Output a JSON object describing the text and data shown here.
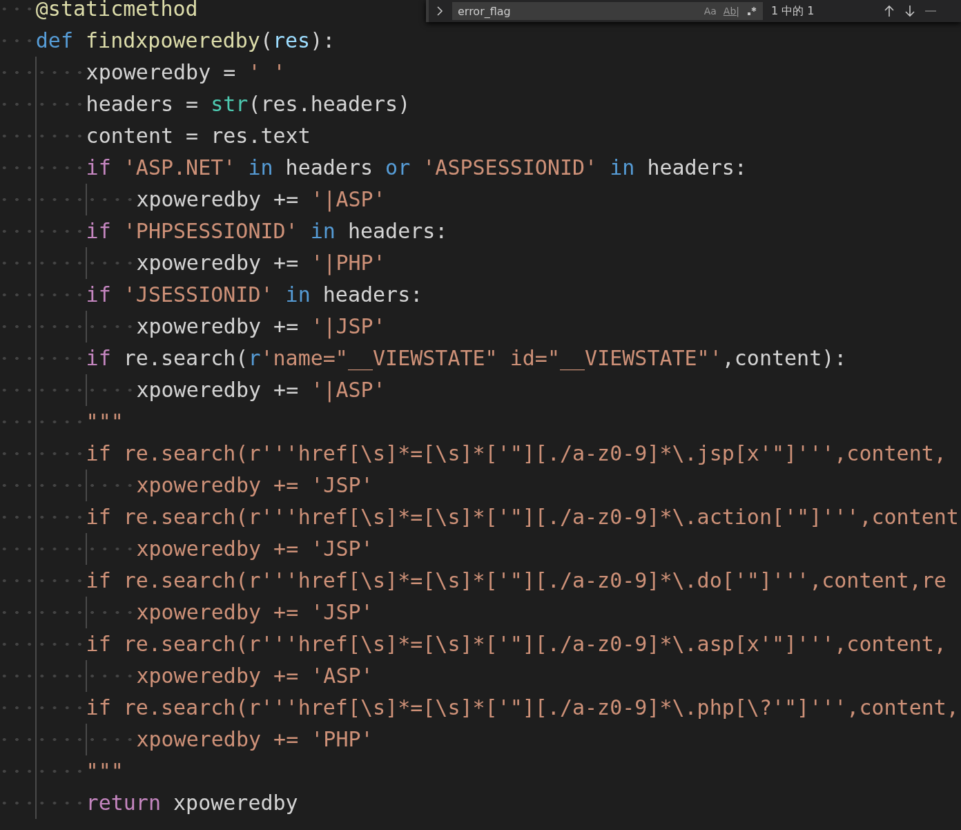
{
  "find_widget": {
    "query": "error_flag",
    "options": [
      "Aa",
      "Ab|"
    ],
    "result_count": "1 中的 1"
  },
  "code_lines": [
    {
      "tokens": [
        {
          "kind": "decorator",
          "text": "@staticmethod"
        }
      ]
    },
    {
      "tokens": [
        {
          "kind": "keyword",
          "text": "def "
        },
        {
          "kind": "function",
          "text": "findxpoweredby"
        },
        {
          "kind": "plain",
          "text": "("
        },
        {
          "kind": "param",
          "text": "res"
        },
        {
          "kind": "plain",
          "text": "):"
        }
      ],
      "children": [
        {
          "tokens": [
            {
              "kind": "plain",
              "text": "xpoweredby = "
            },
            {
              "kind": "string",
              "text": "' '"
            }
          ]
        },
        {
          "tokens": [
            {
              "kind": "plain",
              "text": "headers = "
            },
            {
              "kind": "builtin",
              "text": "str"
            },
            {
              "kind": "plain",
              "text": "(res.headers)"
            }
          ]
        },
        {
          "tokens": [
            {
              "kind": "plain",
              "text": "content = res.text"
            }
          ]
        },
        {
          "tokens": [
            {
              "kind": "control",
              "text": "if "
            },
            {
              "kind": "string",
              "text": "'ASP.NET' "
            },
            {
              "kind": "keyword",
              "text": "in "
            },
            {
              "kind": "plain",
              "text": "headers "
            },
            {
              "kind": "keyword",
              "text": "or "
            },
            {
              "kind": "string",
              "text": "'ASPSESSIONID' "
            },
            {
              "kind": "keyword",
              "text": "in "
            },
            {
              "kind": "plain",
              "text": "headers:"
            }
          ],
          "children": [
            {
              "tokens": [
                {
                  "kind": "plain",
                  "text": "xpoweredby += "
                },
                {
                  "kind": "string",
                  "text": "'|ASP'"
                }
              ]
            }
          ]
        },
        {
          "tokens": [
            {
              "kind": "control",
              "text": "if "
            },
            {
              "kind": "string",
              "text": "'PHPSESSIONID' "
            },
            {
              "kind": "keyword",
              "text": "in "
            },
            {
              "kind": "plain",
              "text": "headers:"
            }
          ],
          "children": [
            {
              "tokens": [
                {
                  "kind": "plain",
                  "text": "xpoweredby += "
                },
                {
                  "kind": "string",
                  "text": "'|PHP'"
                }
              ]
            }
          ]
        },
        {
          "tokens": [
            {
              "kind": "control",
              "text": "if "
            },
            {
              "kind": "string",
              "text": "'JSESSIONID' "
            },
            {
              "kind": "keyword",
              "text": "in "
            },
            {
              "kind": "plain",
              "text": "headers:"
            }
          ],
          "children": [
            {
              "tokens": [
                {
                  "kind": "plain",
                  "text": "xpoweredby += "
                },
                {
                  "kind": "string",
                  "text": "'|JSP'"
                }
              ]
            }
          ]
        },
        {
          "tokens": [
            {
              "kind": "control",
              "text": "if "
            },
            {
              "kind": "plain",
              "text": "re.search("
            },
            {
              "kind": "keyword",
              "text": "r"
            },
            {
              "kind": "string",
              "text": "'name=\"__VIEWSTATE\" id=\"__VIEWSTATE\"'"
            },
            {
              "kind": "plain",
              "text": ",content):"
            }
          ],
          "children": [
            {
              "tokens": [
                {
                  "kind": "plain",
                  "text": "xpoweredby += "
                },
                {
                  "kind": "string",
                  "text": "'|ASP'"
                }
              ]
            }
          ]
        },
        {
          "tokens": [
            {
              "kind": "string",
              "text": "\"\"\""
            }
          ]
        },
        {
          "tokens": [
            {
              "kind": "string",
              "text": "if re.search(r'''href[\\s]*=[\\s]*['\"][./a-z0-9]*\\.jsp[x'\"]''',content,"
            }
          ],
          "children": [
            {
              "tokens": [
                {
                  "kind": "string",
                  "text": "xpoweredby += 'JSP'"
                }
              ]
            }
          ]
        },
        {
          "tokens": [
            {
              "kind": "string",
              "text": "if re.search(r'''href[\\s]*=[\\s]*['\"][./a-z0-9]*\\.action['\"]''',content"
            }
          ],
          "children": [
            {
              "tokens": [
                {
                  "kind": "string",
                  "text": "xpoweredby += 'JSP'"
                }
              ]
            }
          ]
        },
        {
          "tokens": [
            {
              "kind": "string",
              "text": "if re.search(r'''href[\\s]*=[\\s]*['\"][./a-z0-9]*\\.do['\"]''',content,re"
            }
          ],
          "children": [
            {
              "tokens": [
                {
                  "kind": "string",
                  "text": "xpoweredby += 'JSP'"
                }
              ]
            }
          ]
        },
        {
          "tokens": [
            {
              "kind": "string",
              "text": "if re.search(r'''href[\\s]*=[\\s]*['\"][./a-z0-9]*\\.asp[x'\"]''',content,"
            }
          ],
          "children": [
            {
              "tokens": [
                {
                  "kind": "string",
                  "text": "xpoweredby += 'ASP'"
                }
              ]
            }
          ]
        },
        {
          "tokens": [
            {
              "kind": "string",
              "text": "if re.search(r'''href[\\s]*=[\\s]*['\"][./a-z0-9]*\\.php[\\?'\"]''',content,"
            }
          ],
          "children": [
            {
              "tokens": [
                {
                  "kind": "string",
                  "text": "xpoweredby += 'PHP'"
                }
              ]
            }
          ]
        },
        {
          "tokens": [
            {
              "kind": "string",
              "text": "\"\"\""
            }
          ]
        },
        {
          "tokens": [
            {
              "kind": "control",
              "text": "return "
            },
            {
              "kind": "plain",
              "text": "xpoweredby"
            }
          ]
        }
      ]
    }
  ]
}
